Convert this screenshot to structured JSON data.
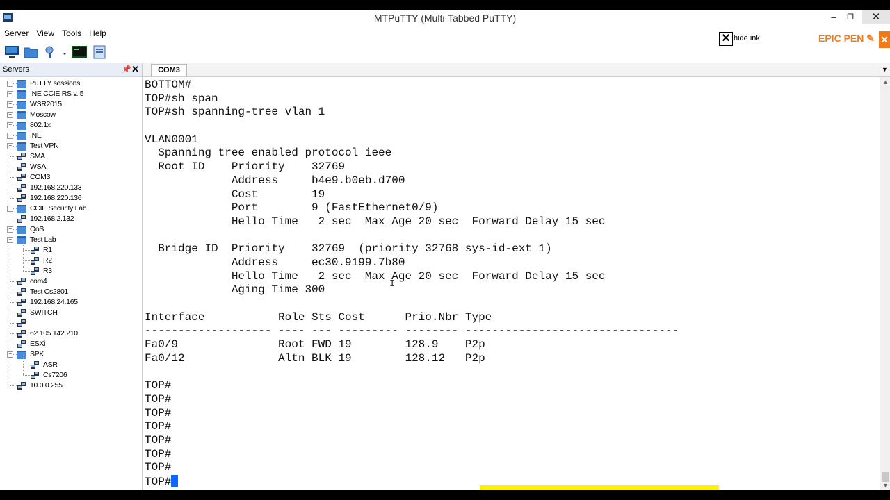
{
  "window": {
    "title": "MTPuTTY (Multi-Tabbed PuTTY)"
  },
  "menu": [
    "Server",
    "View",
    "Tools",
    "Help"
  ],
  "toolbar": {
    "icons": [
      "connect-icon",
      "open-folder-icon",
      "settings-icon",
      "terminal-icon",
      "script-icon"
    ]
  },
  "epic_pen": {
    "hide_ink_label": "hide ink",
    "logo": "EPIC PEN ✎",
    "close_symbol": "✕"
  },
  "servers_panel": {
    "title": "Servers",
    "tree": [
      {
        "label": "PuTTY sessions",
        "type": "folder",
        "level": 0,
        "expander": true
      },
      {
        "label": "INE CCIE RS v. 5",
        "type": "folder",
        "level": 0,
        "expander": true
      },
      {
        "label": "WSR2015",
        "type": "folder",
        "level": 0,
        "expander": true
      },
      {
        "label": "Moscow",
        "type": "folder",
        "level": 0,
        "expander": true
      },
      {
        "label": "802.1x",
        "type": "folder",
        "level": 0,
        "expander": true
      },
      {
        "label": "INE",
        "type": "folder",
        "level": 0,
        "expander": true
      },
      {
        "label": "Test VPN",
        "type": "folder",
        "level": 0,
        "expander": true
      },
      {
        "label": "SMA",
        "type": "session",
        "level": 0
      },
      {
        "label": "WSA",
        "type": "session",
        "level": 0
      },
      {
        "label": "COM3",
        "type": "session",
        "level": 0
      },
      {
        "label": "192.168.220.133",
        "type": "session",
        "level": 0
      },
      {
        "label": "192.168.220.136",
        "type": "session",
        "level": 0
      },
      {
        "label": "CCIE Security Lab",
        "type": "folder",
        "level": 0,
        "expander": true
      },
      {
        "label": "192.168.2.132",
        "type": "session",
        "level": 0
      },
      {
        "label": "QoS",
        "type": "folder",
        "level": 0,
        "expander": true
      },
      {
        "label": "Test Lab",
        "type": "folder",
        "level": 0,
        "expander": true,
        "expanded": true
      },
      {
        "label": "R1",
        "type": "session",
        "level": 1
      },
      {
        "label": "R2",
        "type": "session",
        "level": 1
      },
      {
        "label": "R3",
        "type": "session",
        "level": 1
      },
      {
        "label": "com4",
        "type": "session",
        "level": 0
      },
      {
        "label": "Test Cs2801",
        "type": "session",
        "level": 0
      },
      {
        "label": "192.168.24.165",
        "type": "session",
        "level": 0
      },
      {
        "label": "SWITCH",
        "type": "session",
        "level": 0
      },
      {
        "label": "",
        "type": "session",
        "level": 0
      },
      {
        "label": "62.105.142.210",
        "type": "session",
        "level": 0
      },
      {
        "label": "ESXi",
        "type": "session",
        "level": 0
      },
      {
        "label": "SPK",
        "type": "folder",
        "level": 0,
        "expander": true,
        "expanded": true
      },
      {
        "label": "ASR",
        "type": "session",
        "level": 1
      },
      {
        "label": "Cs7206",
        "type": "session",
        "level": 1
      },
      {
        "label": "10.0.0.255",
        "type": "session",
        "level": 0
      }
    ]
  },
  "tabs": [
    {
      "label": "COM3",
      "active": true
    }
  ],
  "terminal": {
    "lines": [
      "BOTTOM#",
      "TOP#sh span",
      "TOP#sh spanning-tree vlan 1",
      "",
      "VLAN0001",
      "  Spanning tree enabled protocol ieee",
      "  Root ID    Priority    32769",
      "             Address     b4e9.b0eb.d700",
      "             Cost        19",
      "             Port        9 (FastEthernet0/9)",
      "             Hello Time   2 sec  Max Age 20 sec  Forward Delay 15 sec",
      "",
      "  Bridge ID  Priority    32769  (priority 32768 sys-id-ext 1)",
      "             Address     ec30.9199.7b80",
      "             Hello Time   2 sec  Max Age 20 sec  Forward Delay 15 sec",
      "             Aging Time 300",
      "",
      "Interface           Role Sts Cost      Prio.Nbr Type",
      "------------------- ---- --- --------- -------- --------------------------------",
      "Fa0/9               Root FWD 19        128.9    P2p",
      "Fa0/12              Altn BLK 19        128.12   P2p",
      "",
      "TOP#",
      "TOP#",
      "TOP#",
      "TOP#",
      "TOP#",
      "TOP#",
      "TOP#"
    ],
    "prompt_line": "TOP#"
  },
  "colors": {
    "cursor": "#0a66ff",
    "folder": "#4a8ad6",
    "epic_pen": "#f07b1a",
    "highlight": "#fff200"
  }
}
